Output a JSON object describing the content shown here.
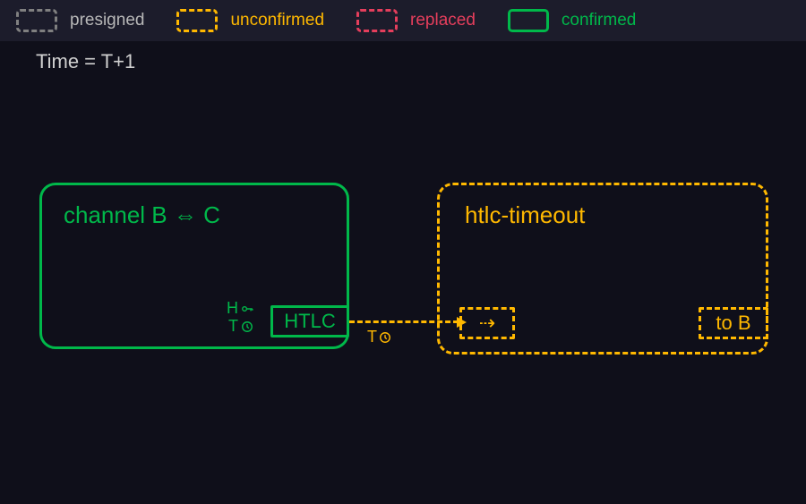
{
  "legend": {
    "presigned": "presigned",
    "unconfirmed": "unconfirmed",
    "replaced": "replaced",
    "confirmed": "confirmed"
  },
  "time_label": "Time = T+1",
  "channel": {
    "title": "channel B ⇔ C",
    "htlc_label": "HTLC",
    "hash_cond": "H",
    "time_cond": "T"
  },
  "timeout": {
    "title": "htlc-timeout",
    "input_label": "⇢",
    "output_label": "to B"
  },
  "edge": {
    "label": "T"
  },
  "colors": {
    "presigned": "#808080",
    "unconfirmed": "#ffb800",
    "replaced": "#e53e5c",
    "confirmed": "#00b84a",
    "bg": "#0f0f1a"
  },
  "chart_data": {
    "type": "diagram",
    "title": "HTLC timeout path at Time = T+1",
    "states": [
      {
        "name": "presigned",
        "style": "dashed",
        "color": "#808080"
      },
      {
        "name": "unconfirmed",
        "style": "dashed",
        "color": "#ffb800"
      },
      {
        "name": "replaced",
        "style": "dashed",
        "color": "#e53e5c"
      },
      {
        "name": "confirmed",
        "style": "solid",
        "color": "#00b84a"
      }
    ],
    "nodes": [
      {
        "id": "channel_BC",
        "label": "channel B ⇔ C",
        "state": "confirmed",
        "outputs": [
          {
            "id": "htlc_out",
            "label": "HTLC",
            "spend_conditions": [
              "hash H",
              "timelock T"
            ]
          }
        ]
      },
      {
        "id": "htlc_timeout_tx",
        "label": "htlc-timeout",
        "state": "unconfirmed",
        "inputs": [
          {
            "id": "in0",
            "label": "⇢"
          }
        ],
        "outputs": [
          {
            "id": "to_B",
            "label": "to B"
          }
        ]
      }
    ],
    "edges": [
      {
        "from": "channel_BC.htlc_out",
        "to": "htlc_timeout_tx.in0",
        "condition": "timelock T",
        "state": "unconfirmed"
      }
    ]
  }
}
